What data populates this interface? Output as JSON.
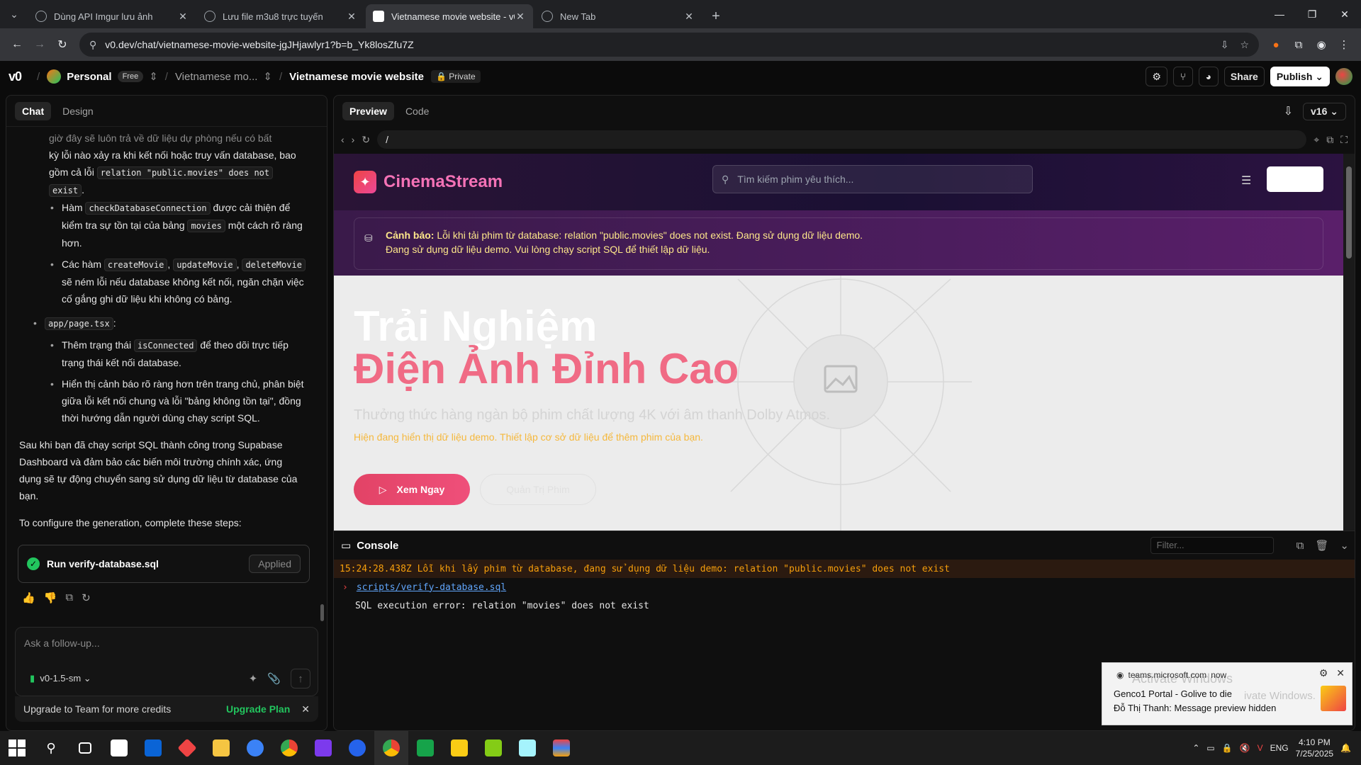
{
  "browser": {
    "tabs": [
      {
        "title": "Dùng API Imgur lưu ảnh",
        "active": false
      },
      {
        "title": "Lưu file m3u8 trực tuyến",
        "active": false
      },
      {
        "title": "Vietnamese movie website - v0",
        "active": true
      },
      {
        "title": "New Tab",
        "active": false
      }
    ],
    "url": "v0.dev/chat/vietnamese-movie-website-jgJHjawlyr1?b=b_Yk8losZfu7Z"
  },
  "v0": {
    "logo": "v0",
    "workspace": "Personal",
    "plan_badge": "Free",
    "project": "Vietnamese mo...",
    "chat_title": "Vietnamese movie website",
    "visibility": "Private",
    "share_label": "Share",
    "publish_label": "Publish"
  },
  "chat": {
    "tabs": [
      "Chat",
      "Design"
    ],
    "line1": "giờ đây sẽ luôn trả về dữ liệu dự phòng nếu có bất",
    "line2a": "kỳ lỗi nào xảy ra khi kết nối hoặc truy vấn database,",
    "line2b": "bao gồm cả lỗi",
    "code_rel": "relation \"public.movies\" does not",
    "code_exist": "exist",
    "b2_pre": "Hàm",
    "code_check": "checkDatabaseConnection",
    "b2_mid": "được cải thiện để kiểm tra sự tồn tại của bảng",
    "code_movies": "movies",
    "b2_post": "một cách rõ ràng hơn.",
    "b3_pre": "Các hàm",
    "code_create": "createMovie",
    "code_update": "updateMovie",
    "code_delete": "deleteMovie",
    "b3_post": "sẽ ném lỗi nếu database không kết nối, ngăn chặn việc cố gắng ghi dữ liệu khi không có bảng.",
    "code_page": "app/page.tsx",
    "c1_pre": "Thêm trạng thái",
    "code_connected": "isConnected",
    "c1_post": "để theo dõi trực tiếp trạng thái kết nối database.",
    "c2": "Hiển thị cảnh báo rõ ràng hơn trên trang chủ, phân biệt giữa lỗi kết nối chung và lỗi \"bảng không tồn tại\", đồng thời hướng dẫn người dùng chạy script SQL.",
    "para1": "Sau khi bạn đã chạy script SQL thành công trong Supabase Dashboard và đảm bảo các biến môi trường chính xác, ứng dụng sẽ tự động chuyển sang sử dụng dữ liệu từ database của bạn.",
    "para2": "To configure the generation, complete these steps:",
    "step_label": "Run verify-database.sql",
    "step_status": "Applied",
    "composer_placeholder": "Ask a follow-up...",
    "model": "v0-1.5-sm",
    "upgrade_text": "Upgrade to Team for more credits",
    "upgrade_link": "Upgrade Plan"
  },
  "preview": {
    "tabs": [
      "Preview",
      "Code"
    ],
    "version": "v16",
    "path": "/",
    "site": {
      "brand": "CinemaStream",
      "search_placeholder": "Tìm kiếm phim yêu thích...",
      "warn_label": "Cảnh báo:",
      "warn_line1": "Lỗi khi tải phim từ database: relation \"public.movies\" does not exist. Đang sử dụng dữ liệu demo.",
      "warn_line2": "Đang sử dụng dữ liệu demo. Vui lòng chạy script SQL để thiết lập dữ liệu.",
      "hero_title1": "Trải Nghiệm",
      "hero_title2": "Điện Ảnh Đỉnh Cao",
      "hero_sub": "Thưởng thức hàng ngàn bộ phim chất lượng 4K với âm thanh Dolby Atmos.",
      "hero_demo": "Hiện đang hiển thị dữ liệu demo. Thiết lập cơ sở dữ liệu để thêm phim của bạn.",
      "watch_btn": "Xem Ngay",
      "admin_btn": "Quản Trị Phim"
    }
  },
  "console": {
    "title": "Console",
    "filter_placeholder": "Filter...",
    "error_line": "15:24:28.438Z  Lỗi khi lấy phim từ database, đang sử dụng dữ liệu demo: relation \"public.movies\" does not exist",
    "script_link": "scripts/verify-database.sql",
    "sql_error": "SQL execution error: relation \"movies\" does not exist"
  },
  "toast": {
    "source": "teams.microsoft.com",
    "time": "now",
    "line1": "Genco1 Portal - Golive to die",
    "line2": "Đỗ Thị Thanh: Message preview hidden",
    "watermark1": "Activate Windows",
    "watermark2": "ivate Windows."
  },
  "taskbar": {
    "lang": "ENG",
    "time": "4:10 PM",
    "date": "7/25/2025"
  }
}
